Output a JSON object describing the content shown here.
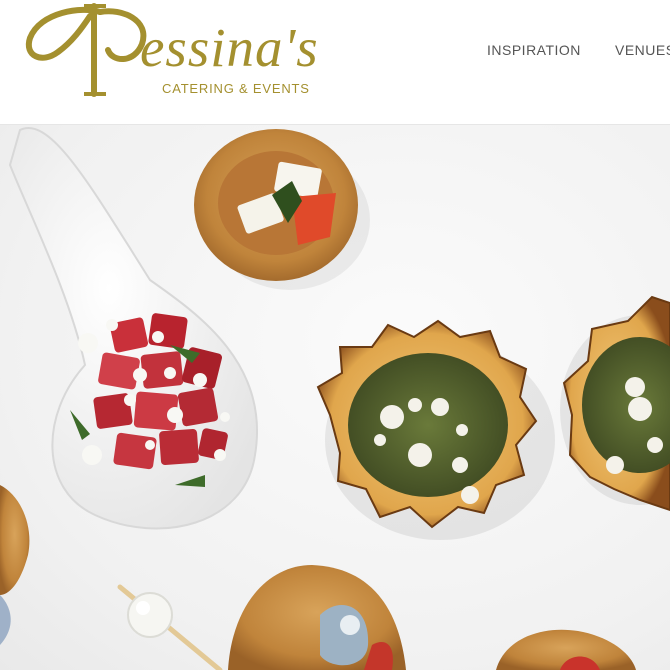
{
  "brand": {
    "name": "essina's",
    "tagline": "CATERING & EVENTS",
    "color": "#a4902f"
  },
  "nav": {
    "items": [
      {
        "label": "INSPIRATION"
      },
      {
        "label": "VENUES"
      }
    ]
  },
  "hero": {
    "image_subject": "hero-food-photo"
  }
}
